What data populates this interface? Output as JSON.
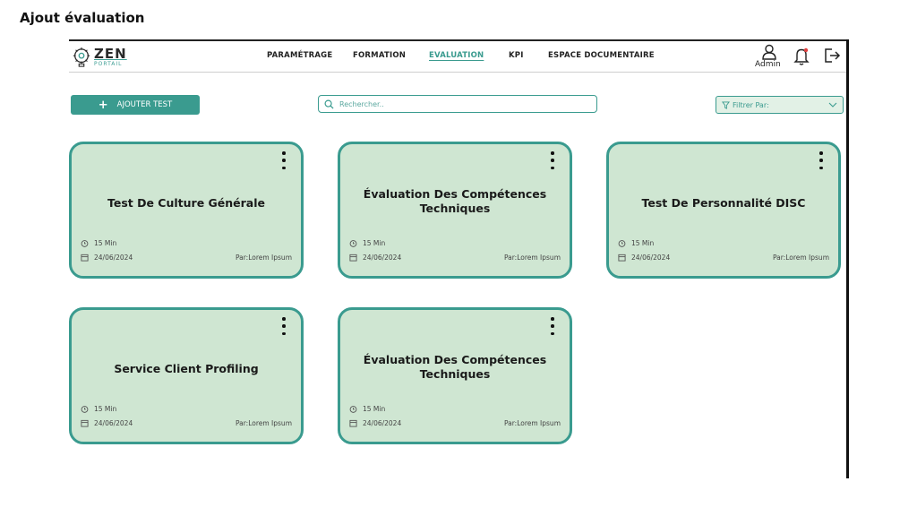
{
  "page_heading": "Ajout évaluation",
  "app": {
    "logo_text": "ZEN",
    "logo_subtitle": "PORTAIL"
  },
  "nav": [
    {
      "label": "PARAMÉTRAGE",
      "active": false
    },
    {
      "label": "FORMATION",
      "active": false
    },
    {
      "label": "EVALUATION",
      "active": true
    },
    {
      "label": "KPI",
      "active": false
    },
    {
      "label": "ESPACE DOCUMENTAIRE",
      "active": false
    }
  ],
  "user": {
    "label": "Admin"
  },
  "toolbar": {
    "add_label": "AJOUTER TEST",
    "search_placeholder": "Rechercher..",
    "filter_label": "Filtrer Par:"
  },
  "cards": [
    {
      "title": "Test De Culture Générale",
      "duration": "15 Min",
      "date": "24/06/2024",
      "author": "Par:Lorem Ipsum"
    },
    {
      "title": "Évaluation Des Compétences Techniques",
      "duration": "15 Min",
      "date": "24/06/2024",
      "author": "Par:Lorem Ipsum"
    },
    {
      "title": "Test De Personnalité DISC",
      "duration": "15 Min",
      "date": "24/06/2024",
      "author": "Par:Lorem Ipsum"
    },
    {
      "title": "Service Client Profiling",
      "duration": "15 Min",
      "date": "24/06/2024",
      "author": "Par:Lorem Ipsum"
    },
    {
      "title": "Évaluation Des Compétences Techniques",
      "duration": "15 Min",
      "date": "24/06/2024",
      "author": "Par:Lorem Ipsum"
    }
  ],
  "colors": {
    "accent": "#3a9b8f",
    "card_bg": "#cfe6d2",
    "filter_bg": "#e2f1e6"
  }
}
